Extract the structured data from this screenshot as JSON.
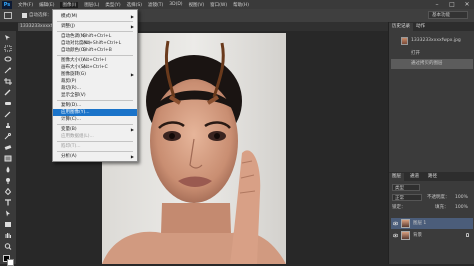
{
  "app": {
    "logo": "Ps"
  },
  "menubar": {
    "items": [
      "文件(F)",
      "编辑(E)",
      "图像(I)",
      "图层(L)",
      "类型(Y)",
      "选择(S)",
      "滤镜(T)",
      "3D(D)",
      "视图(V)",
      "窗口(W)",
      "帮助(H)"
    ],
    "active_index": 2,
    "min": "–",
    "max": "□",
    "close": "✕"
  },
  "options": {
    "check_label": "自动选择：",
    "workspace": "基本功能"
  },
  "document": {
    "tab": "1333233xxxxfwpx..."
  },
  "image_menu": {
    "rows": [
      {
        "label": "模式(M)",
        "shortcut": "",
        "submenu": true,
        "state": "normal"
      },
      {
        "type": "sep"
      },
      {
        "label": "调整(J)",
        "shortcut": "",
        "submenu": true,
        "state": "normal"
      },
      {
        "type": "sep"
      },
      {
        "label": "自动色调(N)",
        "shortcut": "Shift+Ctrl+L",
        "submenu": false,
        "state": "normal"
      },
      {
        "label": "自动对比度(U)",
        "shortcut": "Alt+Shift+Ctrl+L",
        "submenu": false,
        "state": "normal"
      },
      {
        "label": "自动颜色(O)",
        "shortcut": "Shift+Ctrl+B",
        "submenu": false,
        "state": "normal"
      },
      {
        "type": "sep"
      },
      {
        "label": "图像大小(I)...",
        "shortcut": "Alt+Ctrl+I",
        "submenu": false,
        "state": "normal"
      },
      {
        "label": "画布大小(S)...",
        "shortcut": "Alt+Ctrl+C",
        "submenu": false,
        "state": "normal"
      },
      {
        "label": "图像旋转(G)",
        "shortcut": "",
        "submenu": true,
        "state": "normal"
      },
      {
        "label": "裁剪(P)",
        "shortcut": "",
        "submenu": false,
        "state": "normal"
      },
      {
        "label": "裁切(R)...",
        "shortcut": "",
        "submenu": false,
        "state": "normal"
      },
      {
        "label": "显示全部(V)",
        "shortcut": "",
        "submenu": false,
        "state": "normal"
      },
      {
        "type": "sep"
      },
      {
        "label": "复制(D)...",
        "shortcut": "",
        "submenu": false,
        "state": "normal"
      },
      {
        "label": "应用图像(Y)...",
        "shortcut": "",
        "submenu": false,
        "state": "highlighted"
      },
      {
        "label": "计算(C)...",
        "shortcut": "",
        "submenu": false,
        "state": "normal"
      },
      {
        "type": "sep"
      },
      {
        "label": "变量(B)",
        "shortcut": "",
        "submenu": true,
        "state": "normal"
      },
      {
        "label": "应用数据组(L)...",
        "shortcut": "",
        "submenu": false,
        "state": "disabled"
      },
      {
        "type": "sep"
      },
      {
        "label": "陷印(T)...",
        "shortcut": "",
        "submenu": false,
        "state": "disabled"
      },
      {
        "type": "sep"
      },
      {
        "label": "分析(A)",
        "shortcut": "",
        "submenu": true,
        "state": "normal"
      }
    ]
  },
  "history_panel": {
    "tabs": [
      "历史记录",
      "动作"
    ],
    "snapshot": "1333233xxxxfwpx.jpg",
    "items": [
      "打开",
      "通过拷贝的图层"
    ],
    "selected_index": 1
  },
  "layers_panel": {
    "tabs": [
      "图层",
      "通道",
      "路径"
    ],
    "kind_label": "类型",
    "blend_mode": "正常",
    "opacity_label": "不透明度：",
    "opacity": "100%",
    "lock_label": "锁定：",
    "fill_label": "填充：",
    "fill": "100%",
    "layers": [
      {
        "name": "图层 1",
        "selected": true
      },
      {
        "name": "背景",
        "selected": false
      }
    ]
  },
  "colors": {
    "highlight": "#1a73c9",
    "menu_bg": "#f0f0f0",
    "panel_bg": "#3b3b3b",
    "ui_dark": "#282828"
  }
}
